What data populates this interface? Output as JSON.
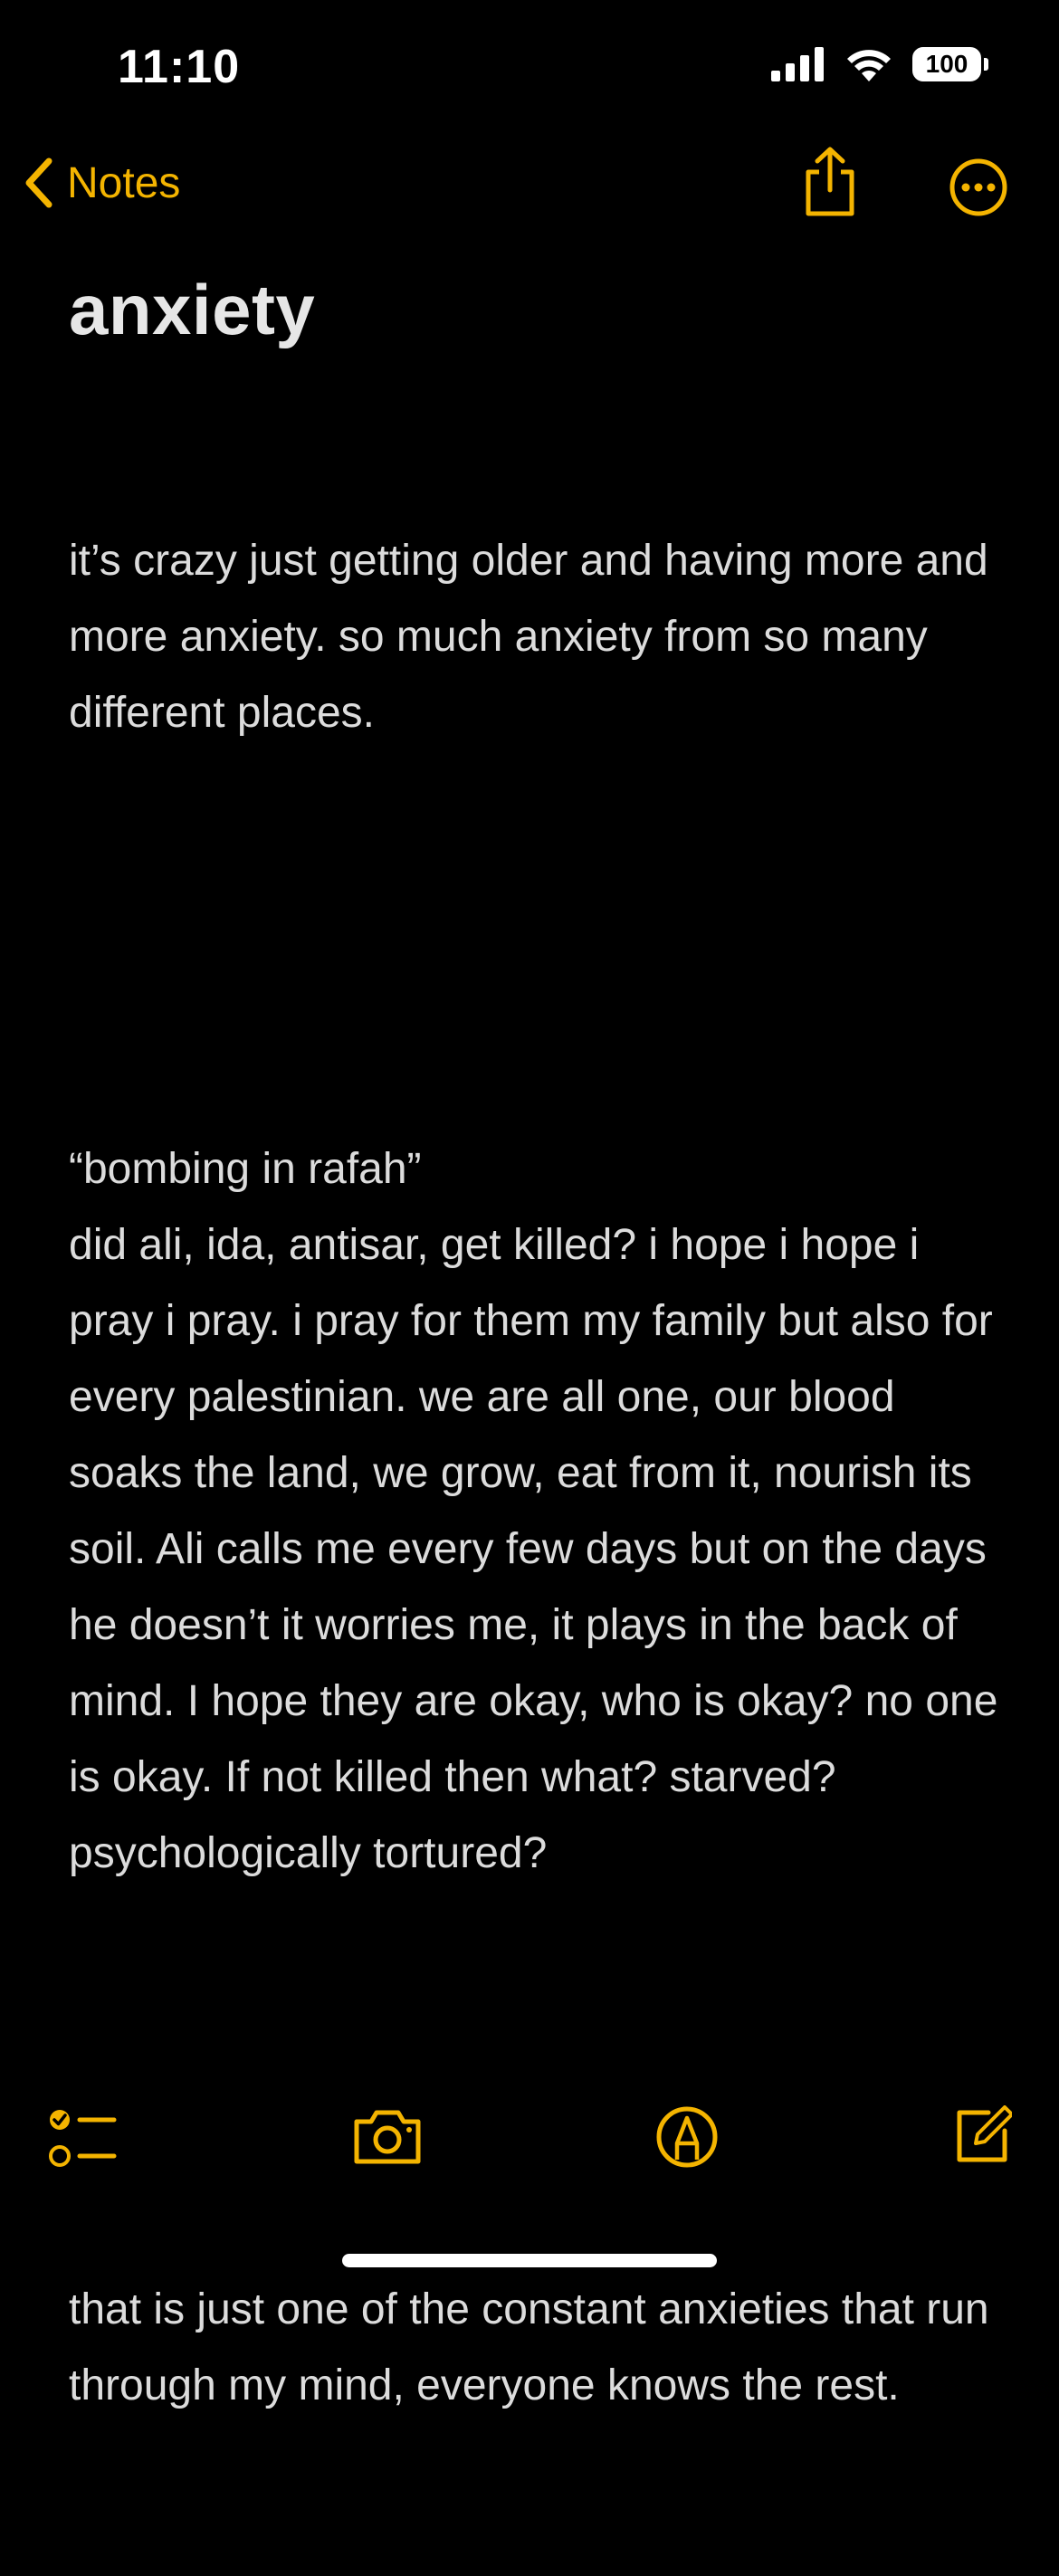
{
  "status_bar": {
    "time": "11:10",
    "battery": "100"
  },
  "nav": {
    "back_label": "Notes"
  },
  "note": {
    "title": "anxiety",
    "paragraphs": [
      "it’s crazy just getting older and having more and more anxiety. so much anxiety from so many different places.",
      "“bombing in rafah”\ndid ali, ida, antisar, get killed? i hope i hope i pray i pray. i pray for them my family but also for every palestinian. we are all one, our blood soaks the land, we grow, eat from it, nourish its soil. Ali calls me every few days but on the days he doesn’t it worries me, it plays in the back of mind. I hope they are okay, who is okay? no one is okay. If not killed then what? starved? psychologically tortured?",
      "that is just one of the constant anxieties that run through my mind, everyone knows the rest."
    ]
  },
  "colors": {
    "accent": "#f4b400",
    "background": "#000000",
    "text": "#dcdcdc"
  },
  "icons": {
    "back": "chevron-left-icon",
    "share": "share-icon",
    "more": "ellipsis-circle-icon",
    "checklist": "checklist-icon",
    "camera": "camera-icon",
    "markup": "markup-pen-icon",
    "compose": "compose-icon"
  }
}
